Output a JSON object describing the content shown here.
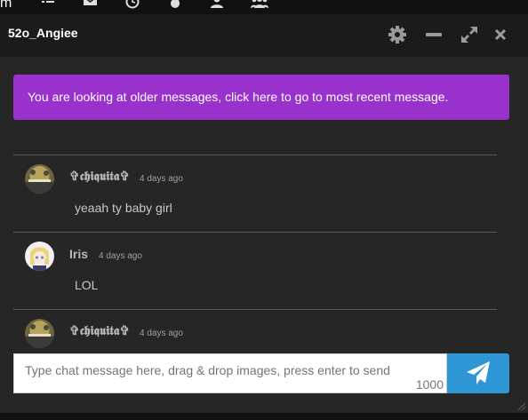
{
  "topbar": {
    "fragment_text": "m",
    "icons": [
      "list-icon",
      "mail-icon",
      "clock-icon",
      "fire-icon",
      "user-icon",
      "users-icon"
    ]
  },
  "chat": {
    "title": "52o_Angiee",
    "header_icons": [
      "gear-icon",
      "minimize-icon",
      "expand-icon",
      "close-icon"
    ],
    "older_banner": "You are looking at older messages, click here to go to most recent message.",
    "messages": [
      {
        "user": "✞𝖈𝖍𝖎𝖖𝖚𝖎𝖙𝖆✞",
        "time": "4 days ago",
        "text": "yeaah ty baby girl"
      },
      {
        "user": "Iris",
        "time": "4 days ago",
        "text": "LOL"
      },
      {
        "user": "✞𝖈𝖍𝖎𝖖𝖚𝖎𝖙𝖆✞",
        "time": "4 days ago",
        "text": ""
      }
    ],
    "input": {
      "placeholder": "Type chat message here, drag & drop images, press enter to send",
      "char_remaining": "1000"
    },
    "send_icon": "paper-plane-icon"
  },
  "colors": {
    "banner": "#9932cc",
    "send_button": "#2f96d6",
    "window_bg": "#262626",
    "header_bg": "#1b1b1b"
  }
}
